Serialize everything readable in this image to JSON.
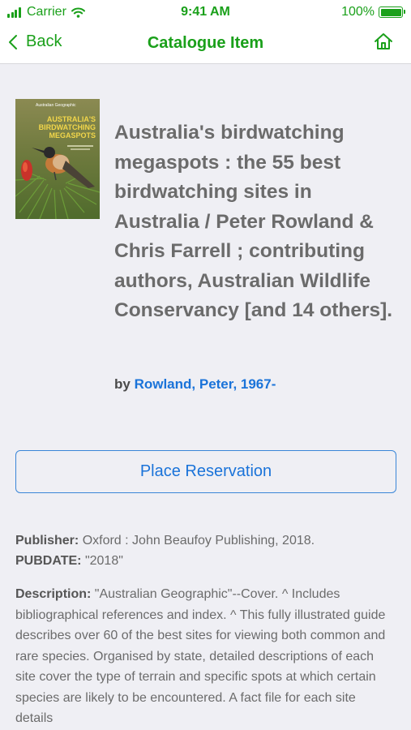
{
  "status_bar": {
    "carrier": "Carrier",
    "time": "9:41 AM",
    "battery": "100%",
    "accent_color": "#1aa01a"
  },
  "nav": {
    "back_label": "Back",
    "title": "Catalogue Item",
    "home_icon": "home-icon"
  },
  "item": {
    "cover": {
      "brand": "Australian Geographic",
      "title_lines": [
        "AUSTRALIA'S",
        "BIRDWATCHING",
        "MEGASPOTS"
      ]
    },
    "title": "Australia's birdwatching megaspots : the 55 best birdwatching sites in Australia / Peter Rowland & Chris Farrell ; contributing authors, Australian Wildlife Conservancy [and 14 others].",
    "by_prefix": "by",
    "author": "Rowland, Peter, 1967-"
  },
  "actions": {
    "reserve_label": "Place Reservation"
  },
  "details": {
    "publisher_label": "Publisher:",
    "publisher": "Oxford : John Beaufoy Publishing, 2018.",
    "pubdate_label": "PUBDATE:",
    "pubdate": "\"2018\"",
    "description_label": "Description:",
    "description": "\"Australian Geographic\"--Cover. ^ Includes bibliographical references and index. ^ This fully illustrated guide describes over 60 of the best sites for viewing both common and rare species. Organised by state, detailed descriptions of each site cover the type of terrain and specific spots at which certain species are likely to be encountered. A fact file for each site details"
  }
}
